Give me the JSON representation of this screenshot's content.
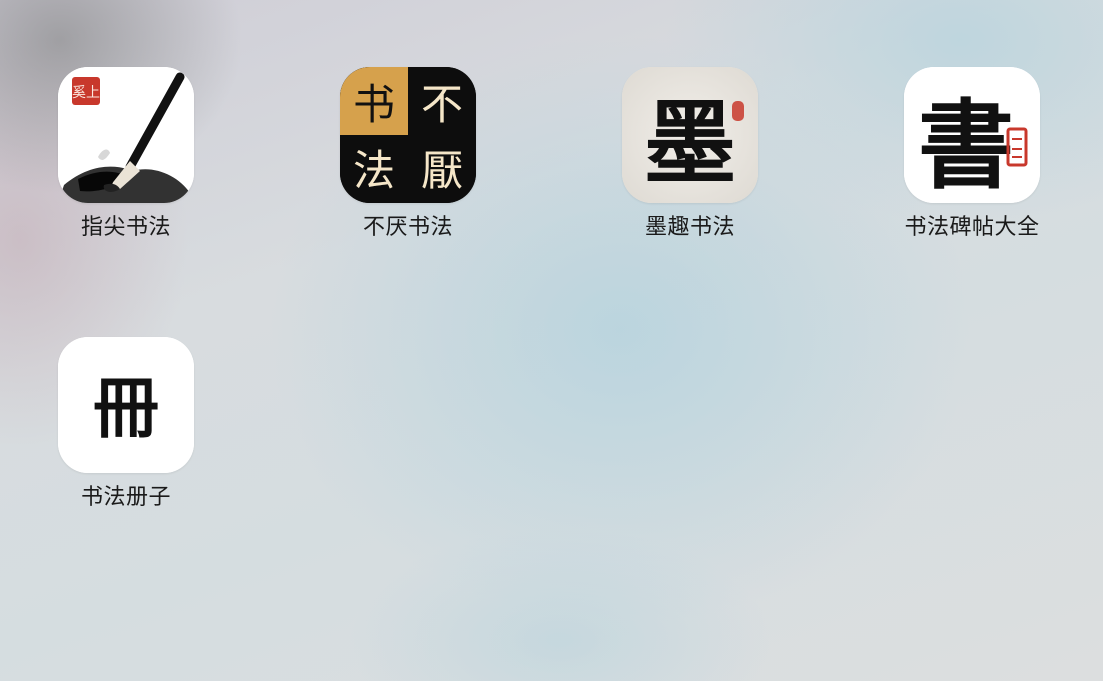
{
  "apps": [
    {
      "label": "指尖书法",
      "icon": "brush-ink-icon",
      "seal": "奚上"
    },
    {
      "label": "不厌书法",
      "icon": "buyan-calligraphy-icon",
      "glyphs": [
        "书",
        "不",
        "法",
        "厭"
      ]
    },
    {
      "label": "墨趣书法",
      "icon": "mo-character-icon",
      "glyph": "墨"
    },
    {
      "label": "书法碑帖大全",
      "icon": "shu-character-icon",
      "glyph": "書"
    },
    {
      "label": "书法册子",
      "icon": "ce-character-icon",
      "glyph": "冊"
    }
  ],
  "colors": {
    "label": "#1a1a1a",
    "seal_red": "#c8382c",
    "gold": "#d6a14c",
    "cream": "#f5e6c8",
    "ink": "#111111"
  }
}
